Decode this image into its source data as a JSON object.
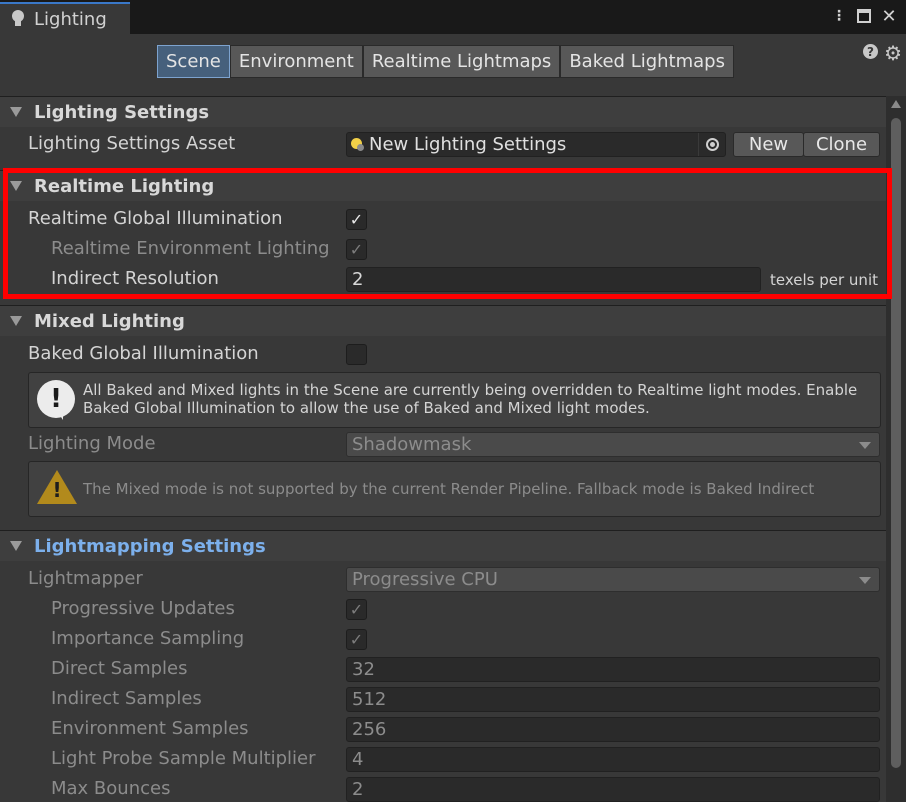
{
  "window": {
    "tab_title": "Lighting",
    "controls": [
      "kebab-menu",
      "maximize",
      "close"
    ]
  },
  "modes": {
    "items": [
      "Scene",
      "Environment",
      "Realtime Lightmaps",
      "Baked Lightmaps"
    ],
    "active": "Scene"
  },
  "icons": {
    "help": "?",
    "gear": "⚙",
    "check": "✓",
    "info": "!",
    "warning": "!"
  },
  "colors": {
    "accent": "#3a78c8",
    "highlight": "#ff0000",
    "section_link": "#7cb0ec"
  },
  "lighting_settings": {
    "title": "Lighting Settings",
    "asset_label": "Lighting Settings Asset",
    "asset_value": "New Lighting Settings",
    "new_button": "New",
    "clone_button": "Clone"
  },
  "realtime_lighting": {
    "title": "Realtime Lighting",
    "rgi_label": "Realtime Global Illumination",
    "rgi_checked": true,
    "env_label": "Realtime Environment Lighting",
    "env_checked": true,
    "indirect_label": "Indirect Resolution",
    "indirect_value": "2",
    "indirect_suffix": "texels per unit"
  },
  "mixed_lighting": {
    "title": "Mixed Lighting",
    "baked_gi_label": "Baked Global Illumination",
    "baked_gi_checked": false,
    "info_message": "All Baked and Mixed lights in the Scene are currently being overridden to Realtime light modes. Enable Baked Global Illumination to allow the use of Baked and Mixed light modes.",
    "mode_label": "Lighting Mode",
    "mode_value": "Shadowmask",
    "warning_message": "The Mixed mode is not supported by the current Render Pipeline. Fallback mode is Baked Indirect"
  },
  "lightmapping": {
    "title": "Lightmapping Settings",
    "lightmapper_label": "Lightmapper",
    "lightmapper_value": "Progressive CPU",
    "progressive_updates_label": "Progressive Updates",
    "importance_sampling_label": "Importance Sampling",
    "direct_samples_label": "Direct Samples",
    "direct_samples_value": "32",
    "indirect_samples_label": "Indirect Samples",
    "indirect_samples_value": "512",
    "environment_samples_label": "Environment Samples",
    "environment_samples_value": "256",
    "light_probe_label": "Light Probe Sample Multiplier",
    "light_probe_value": "4",
    "max_bounces_label": "Max Bounces",
    "max_bounces_value": "2"
  }
}
